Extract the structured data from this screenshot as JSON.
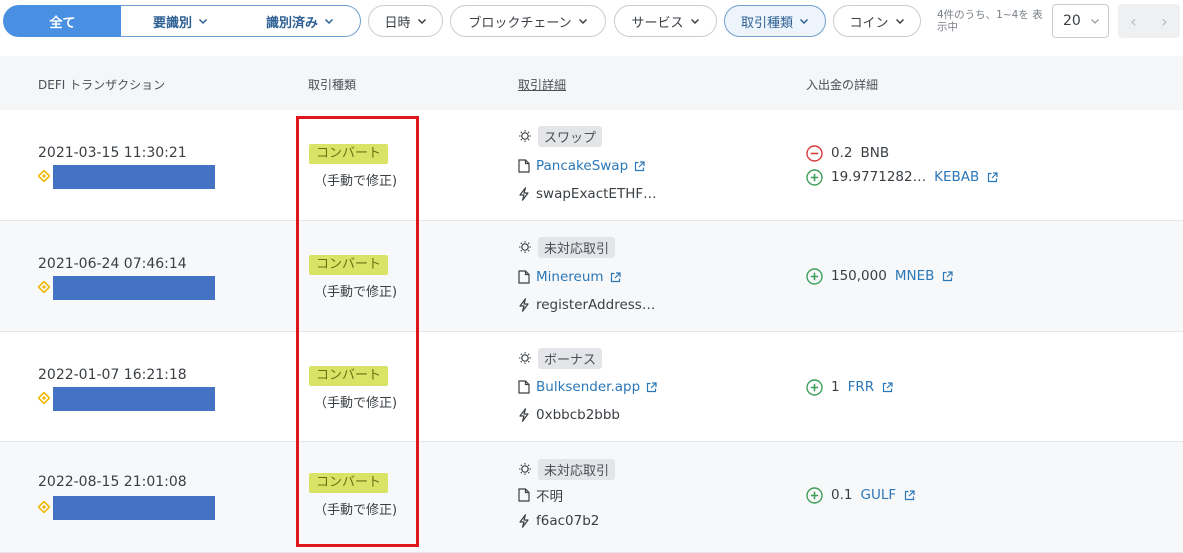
{
  "filters": {
    "all": "全て",
    "needs_review": "要識別",
    "identified": "識別済み",
    "date": "日時",
    "blockchain": "ブロックチェーン",
    "service": "サービス",
    "tx_type": "取引種類",
    "coin": "コイン"
  },
  "pagination": {
    "info": "4件のうち、1~4を 表示中",
    "page_size": "20",
    "prev": "‹",
    "next": "›"
  },
  "table": {
    "headers": {
      "defi_tx": "DEFI トランザクション",
      "tx_type": "取引種類",
      "tx_detail": "取引詳細",
      "flow_detail": "入出金の詳細"
    },
    "rows": [
      {
        "datetime": "2021-03-15 11:30:21",
        "type_label": "コンバート",
        "type_note": "（手動で修正)",
        "detail_badge": "スワップ",
        "service": "PancakeSwap",
        "method": "swapExactETHF…",
        "flows": [
          {
            "direction": "out",
            "amount": "0.2",
            "token": "BNB",
            "token_link": false
          },
          {
            "direction": "in",
            "amount": "19.9771282…",
            "token": "KEBAB",
            "token_link": true
          }
        ]
      },
      {
        "datetime": "2021-06-24 07:46:14",
        "type_label": "コンバート",
        "type_note": "（手動で修正)",
        "detail_badge": "未対応取引",
        "service": "Minereum",
        "method": "registerAddress…",
        "flows": [
          {
            "direction": "in",
            "amount": "150,000",
            "token": "MNEB",
            "token_link": true
          }
        ]
      },
      {
        "datetime": "2022-01-07 16:21:18",
        "type_label": "コンバート",
        "type_note": "（手動で修正)",
        "detail_badge": "ボーナス",
        "service": "Bulksender.app",
        "method": "0xbbcb2bbb",
        "flows": [
          {
            "direction": "in",
            "amount": "1",
            "token": "FRR",
            "token_link": true
          }
        ]
      },
      {
        "datetime": "2022-08-15 21:01:08",
        "type_label": "コンバート",
        "type_note": "（手動で修正)",
        "detail_badge": "未対応取引",
        "service": "不明",
        "method": "f6ac07b2",
        "flows": [
          {
            "direction": "in",
            "amount": "0.1",
            "token": "GULF",
            "token_link": true
          }
        ]
      }
    ]
  },
  "icons": {
    "chevron": "chevron-down-icon",
    "bulb": "lightbulb-icon",
    "file": "file-icon",
    "bolt": "lightning-icon",
    "external": "external-link-icon",
    "minus": "minus-circle-icon",
    "plus": "plus-circle-icon",
    "coin": "bnb-coin-icon"
  },
  "colors": {
    "accent": "#4a90e2",
    "link": "#2b77b8",
    "convert_badge": "#d9e467",
    "outflow": "#d93a3a",
    "inflow": "#3f9e5a",
    "highlight": "#e0161b",
    "redaction": "#4472c4"
  }
}
